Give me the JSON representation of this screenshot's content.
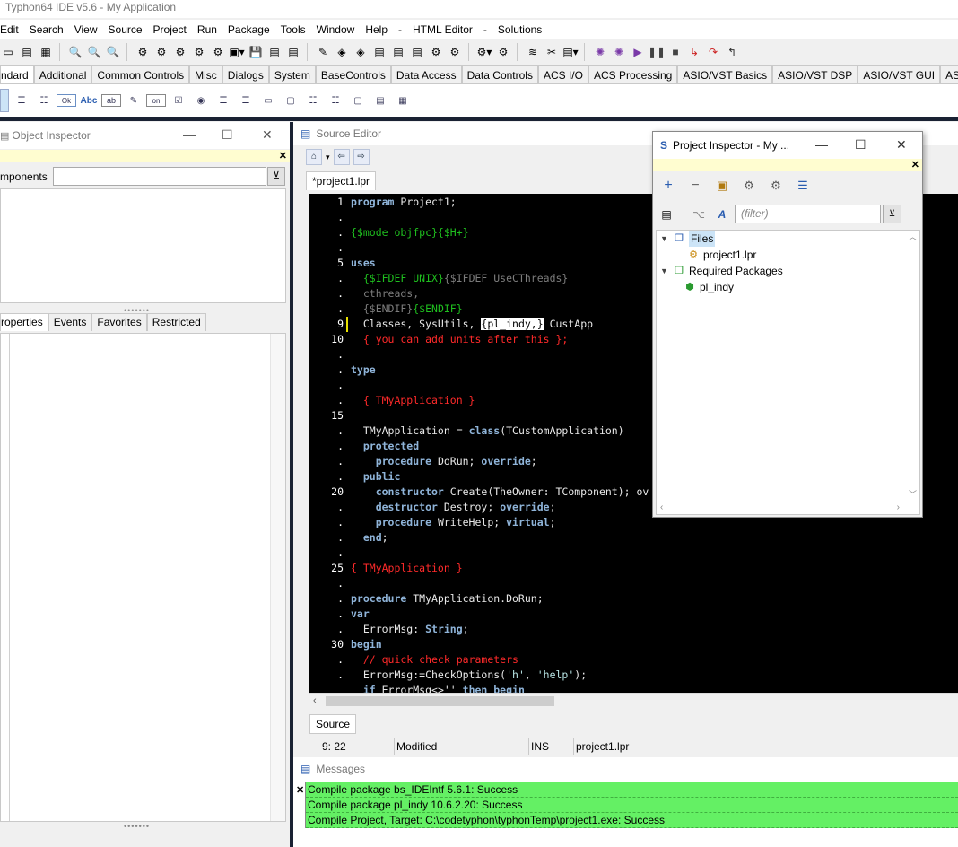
{
  "window": {
    "title": "Typhon64 IDE v5.6 - My Application"
  },
  "menu": [
    "Edit",
    "Search",
    "View",
    "Source",
    "Project",
    "Run",
    "Package",
    "Tools",
    "Window",
    "Help",
    "-",
    "HTML Editor",
    "-",
    "Solutions"
  ],
  "palette": {
    "tabs": [
      "ndard",
      "Additional",
      "Common Controls",
      "Misc",
      "Dialogs",
      "System",
      "BaseControls",
      "Data Access",
      "Data Controls",
      "ACS I/O",
      "ACS Processing",
      "ASIO/VST Basics",
      "ASIO/VST DSP",
      "ASIO/VST GUI",
      "ASIO/"
    ],
    "active_tab": "ndard",
    "component_labels": {
      "button": "Ok",
      "label": "Abc",
      "edit": "ab",
      "toggle": "on"
    }
  },
  "object_inspector": {
    "title": "Object Inspector",
    "components_label": "mponents",
    "components_value": "",
    "tabs": [
      "roperties",
      "Events",
      "Favorites",
      "Restricted"
    ],
    "active_tab": "roperties"
  },
  "source_editor": {
    "title": "Source Editor",
    "file_tab": "*project1.lpr",
    "bottom_tab": "Source",
    "status": {
      "position": "9: 22",
      "state": "Modified",
      "mode": "INS",
      "file": "project1.lpr"
    },
    "gutter": [
      "1",
      ".",
      ".",
      ".",
      "5",
      ".",
      ".",
      ".",
      "9",
      "10",
      ".",
      ".",
      ".",
      ".",
      "15",
      ".",
      ".",
      ".",
      ".",
      "20",
      ".",
      ".",
      ".",
      ".",
      "25",
      ".",
      ".",
      ".",
      ".",
      "30",
      ".",
      "."
    ],
    "lines": [
      [
        [
          "kw",
          "program"
        ],
        [
          "tx",
          " Project1;"
        ]
      ],
      [],
      [
        [
          "dir",
          "{$mode objfpc}{$H+}"
        ]
      ],
      [],
      [
        [
          "kw",
          "uses"
        ]
      ],
      [
        [
          "tx",
          "  "
        ],
        [
          "dir",
          "{$IFDEF UNIX}"
        ],
        [
          "gray",
          "{$IFDEF UseCThreads}"
        ]
      ],
      [
        [
          "gray",
          "  cthreads,"
        ]
      ],
      [
        [
          "gray",
          "  {$ENDIF}"
        ],
        [
          "dir",
          "{$ENDIF}"
        ]
      ],
      [
        [
          "tx",
          "  Classes, SysUtils, "
        ],
        [
          "sel",
          "{pl_indy,}"
        ],
        [
          "tx",
          " CustApp"
        ]
      ],
      [
        [
          "red",
          "  { you can add units after this };"
        ]
      ],
      [],
      [
        [
          "kw",
          "type"
        ]
      ],
      [],
      [
        [
          "red",
          "  { TMyApplication }"
        ]
      ],
      [],
      [
        [
          "tx",
          "  TMyApplication = "
        ],
        [
          "kw",
          "class"
        ],
        [
          "tx",
          "(TCustomApplication)"
        ]
      ],
      [
        [
          "kw",
          "  protected"
        ]
      ],
      [
        [
          "kw",
          "    procedure"
        ],
        [
          "tx",
          " DoRun; "
        ],
        [
          "kw",
          "override"
        ],
        [
          "tx",
          ";"
        ]
      ],
      [
        [
          "kw",
          "  public"
        ]
      ],
      [
        [
          "kw",
          "    constructor"
        ],
        [
          "tx",
          " Create(TheOwner: TComponent); ov"
        ]
      ],
      [
        [
          "kw",
          "    destructor"
        ],
        [
          "tx",
          " Destroy; "
        ],
        [
          "kw",
          "override"
        ],
        [
          "tx",
          ";"
        ]
      ],
      [
        [
          "kw",
          "    procedure"
        ],
        [
          "tx",
          " WriteHelp; "
        ],
        [
          "kw",
          "virtual"
        ],
        [
          "tx",
          ";"
        ]
      ],
      [
        [
          "kw",
          "  end"
        ],
        [
          "tx",
          ";"
        ]
      ],
      [],
      [
        [
          "red",
          "{ TMyApplication }"
        ]
      ],
      [],
      [
        [
          "kw",
          "procedure"
        ],
        [
          "tx",
          " TMyApplication.DoRun;"
        ]
      ],
      [
        [
          "kw",
          "var"
        ]
      ],
      [
        [
          "tx",
          "  ErrorMsg: "
        ],
        [
          "kw",
          "String"
        ],
        [
          "tx",
          ";"
        ]
      ],
      [
        [
          "kw",
          "begin"
        ]
      ],
      [
        [
          "red",
          "  // quick check parameters"
        ]
      ],
      [
        [
          "tx",
          "  ErrorMsg:=CheckOptions("
        ],
        [
          "str",
          "'h'"
        ],
        [
          "tx",
          ", "
        ],
        [
          "str",
          "'help'"
        ],
        [
          "tx",
          ");"
        ]
      ],
      [
        [
          "kw",
          "  if"
        ],
        [
          "tx",
          " ErrorMsg<>'' "
        ],
        [
          "kw",
          "then begin"
        ]
      ]
    ]
  },
  "messages": {
    "title": "Messages",
    "lines": [
      "Compile package bs_IDEIntf 5.6.1: Success",
      "Compile package pl_indy 10.6.2.20: Success",
      "Compile Project, Target: C:\\codetyphon\\typhonTemp\\project1.exe: Success"
    ]
  },
  "project_inspector": {
    "title": "Project Inspector - My ...",
    "filter_placeholder": "(filter)",
    "tree": [
      {
        "label": "Files",
        "level": 0,
        "icon": "files-icon",
        "expanded": true,
        "selected": true
      },
      {
        "label": "project1.lpr",
        "level": 1,
        "icon": "project-file-icon"
      },
      {
        "label": "Required Packages",
        "level": 0,
        "icon": "packages-icon",
        "expanded": true
      },
      {
        "label": "pl_indy",
        "level": 1,
        "icon": "package-icon"
      }
    ]
  },
  "colors": {
    "editor_bg": "#000000",
    "keyword": "#8fb4d9",
    "directive": "#1fc01f",
    "comment": "#ff2a2a",
    "message_success": "#64f064",
    "panel_yellow": "#fffdd0"
  }
}
